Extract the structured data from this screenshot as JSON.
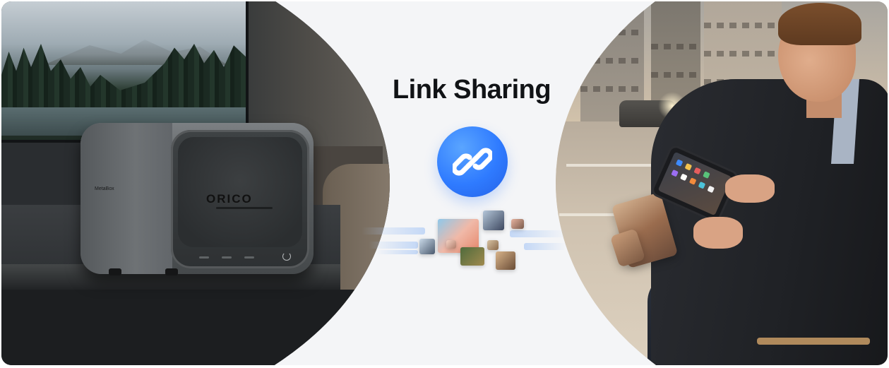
{
  "title": "Link Sharing",
  "device": {
    "brand": "ORICO",
    "model": "MetaBox"
  },
  "icons": {
    "center": "link-icon"
  },
  "colors": {
    "badge": "#2f7bff",
    "background": "#f4f5f7",
    "title": "#111316"
  }
}
